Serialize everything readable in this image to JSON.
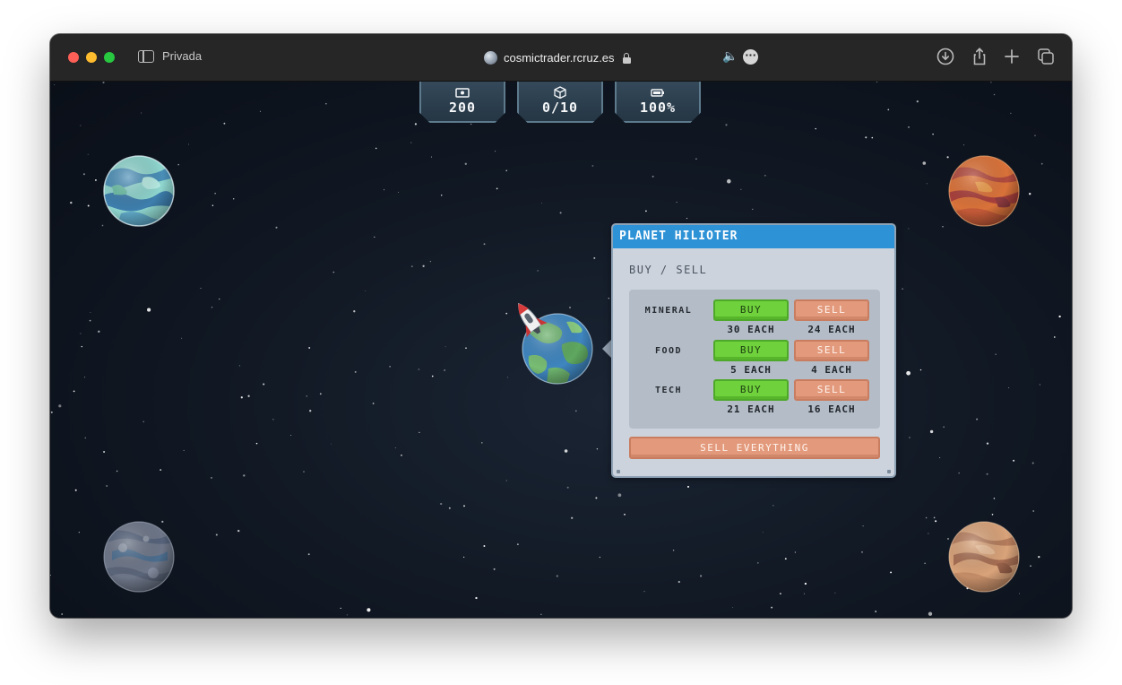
{
  "browser": {
    "mode_label": "Privada",
    "url": "cosmictrader.rcruz.es"
  },
  "hud": {
    "money": "200",
    "cargo": "0/10",
    "fuel": "100%"
  },
  "dialog": {
    "title": "PLANET HILIOTER",
    "section": "BUY / SELL",
    "goods": [
      {
        "name": "MINERAL",
        "buy_label": "BUY",
        "sell_label": "SELL",
        "buy_price": "30 EACH",
        "sell_price": "24 EACH"
      },
      {
        "name": "FOOD",
        "buy_label": "BUY",
        "sell_label": "SELL",
        "buy_price": "5 EACH",
        "sell_price": "4 EACH"
      },
      {
        "name": "TECH",
        "buy_label": "BUY",
        "sell_label": "SELL",
        "buy_price": "21 EACH",
        "sell_price": "16 EACH"
      }
    ],
    "sell_all_label": "SELL EVERYTHING"
  },
  "colors": {
    "dialog_header": "#2e92d6",
    "buy_button": "#6fd23c",
    "sell_button": "#e39a7c",
    "space_background": "#101722"
  },
  "icons": {
    "money": "banknote-icon",
    "cargo": "cube-icon",
    "fuel": "battery-icon"
  }
}
